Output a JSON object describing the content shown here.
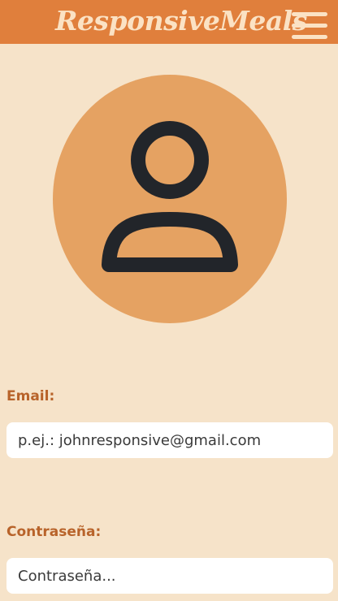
{
  "header": {
    "brand": "ResponsiveMeals",
    "menu_icon": "hamburger-menu-icon"
  },
  "avatar": {
    "icon": "user-profile-icon"
  },
  "form": {
    "email": {
      "label": "Email:",
      "placeholder": "p.ej.: johnresponsive@gmail.com"
    },
    "password": {
      "label": "Contraseña:",
      "placeholder": "Contraseña..."
    }
  },
  "colors": {
    "header_bg": "#e07f3c",
    "brand_text": "#fbe2c4",
    "page_bg": "#f6e3c9",
    "avatar_bg": "#e5a262",
    "icon_stroke": "#22252a",
    "label_text": "#b8632a"
  }
}
